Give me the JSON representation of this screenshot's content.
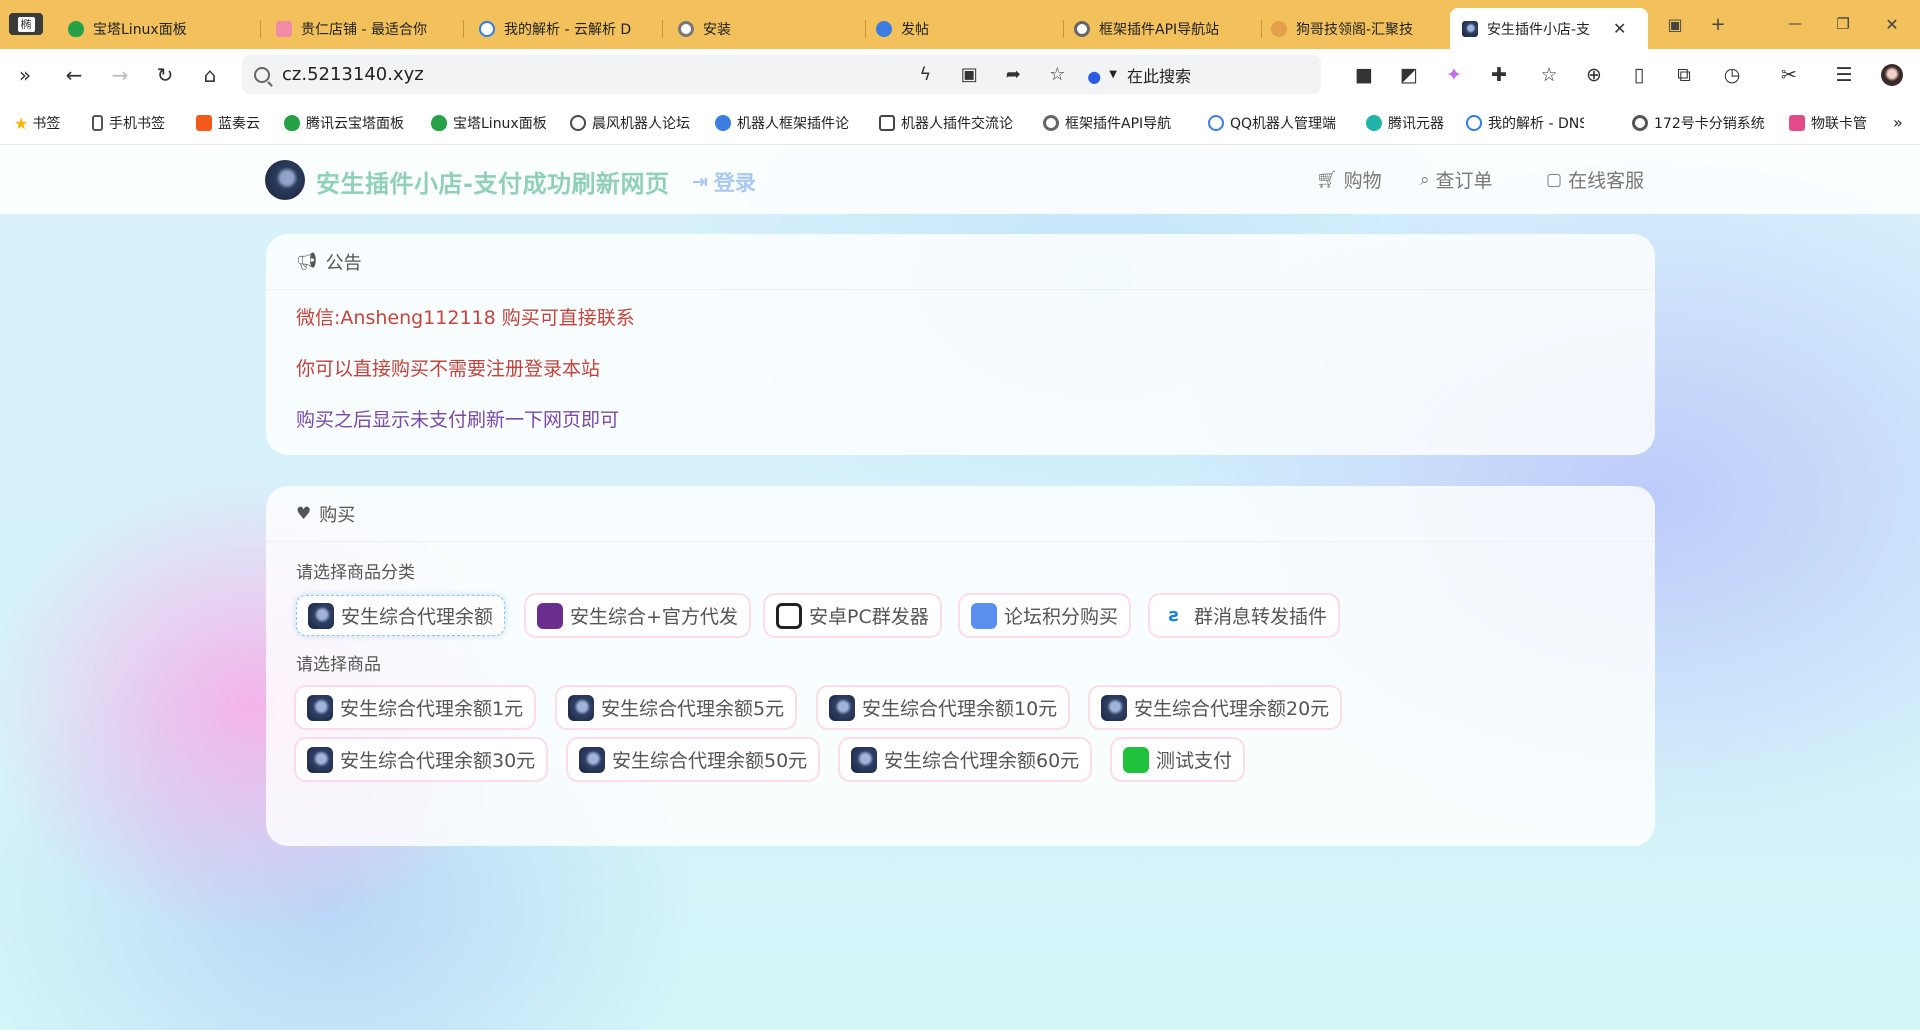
{
  "browser": {
    "tab_menu_label": "椭",
    "tabs": [
      {
        "label": "宝塔Linux面板",
        "color": "#26a148"
      },
      {
        "label": "贵仁店铺 - 最适合你",
        "color": "#f08aa5"
      },
      {
        "label": "我的解析 - 云解析 D",
        "color": "#2b7de9"
      },
      {
        "label": "安装",
        "color": "#777777"
      },
      {
        "label": "发帖",
        "color": "#3b7de0"
      },
      {
        "label": "框架插件API导航站",
        "color": "#666666"
      },
      {
        "label": "狗哥技领阁-汇聚技",
        "color": "#e3a04a"
      },
      {
        "label": "安生插件小店-支",
        "color": "#2c3c5d",
        "active": true
      }
    ],
    "active_tab_close": "✕",
    "new_tab": "+",
    "window_controls": {
      "minimize": "—",
      "restore": "❐",
      "close": "✕"
    },
    "url": "cz.5213140.xyz",
    "search_engine_label": "在此搜索",
    "bookmarks": [
      {
        "label": "书签",
        "color": "#f5b400"
      },
      {
        "label": "手机书签",
        "color": "#555555"
      },
      {
        "label": "蓝奏云",
        "color": "#f25a1a"
      },
      {
        "label": "腾讯云宝塔面板",
        "color": "#26a148"
      },
      {
        "label": "宝塔Linux面板",
        "color": "#26a148"
      },
      {
        "label": "晨风机器人论坛",
        "color": "#4a4a4a"
      },
      {
        "label": "机器人框架插件论",
        "color": "#3b7de0"
      },
      {
        "label": "机器人插件交流论",
        "color": "#444444"
      },
      {
        "label": "框架插件API导航",
        "color": "#666666"
      },
      {
        "label": "QQ机器人管理端",
        "color": "#3b7de0"
      },
      {
        "label": "腾讯元器",
        "color": "#22b4a8"
      },
      {
        "label": "我的解析 - DNS",
        "color": "#2b7de9"
      },
      {
        "label": "172号卡分销系统",
        "color": "#555555"
      },
      {
        "label": "物联卡管",
        "color": "#e24b8a"
      }
    ],
    "bookmarks_more": "»"
  },
  "site": {
    "title": "安生插件小店-支付成功刷新网页",
    "login_label": "登录",
    "nav": [
      {
        "label": "购物",
        "icon": "cart-icon"
      },
      {
        "label": "查订单",
        "icon": "search-icon"
      },
      {
        "label": "在线客服",
        "icon": "chat-icon"
      }
    ]
  },
  "notice": {
    "heading": "公告",
    "lines": [
      {
        "text": "微信:Ansheng112118 购买可直接联系",
        "color": "#c0453c"
      },
      {
        "text": "你可以直接购买不需要注册登录本站",
        "color": "#c0453c"
      },
      {
        "text": "购买之后显示未支付刷新一下网页即可",
        "color": "#7a4aa6"
      }
    ]
  },
  "shop": {
    "heading": "购买",
    "category_label": "请选择商品分类",
    "categories": [
      {
        "label": "安生综合代理余额",
        "selected": true
      },
      {
        "label": "安生综合+官方代发"
      },
      {
        "label": "安卓PC群发器"
      },
      {
        "label": "论坛积分购买"
      },
      {
        "label": "群消息转发插件"
      }
    ],
    "product_label": "请选择商品",
    "products": [
      {
        "label": "安生综合代理余额1元"
      },
      {
        "label": "安生综合代理余额5元"
      },
      {
        "label": "安生综合代理余额10元"
      },
      {
        "label": "安生综合代理余额20元"
      },
      {
        "label": "安生综合代理余额30元"
      },
      {
        "label": "安生综合代理余额50元"
      },
      {
        "label": "安生综合代理余额60元"
      },
      {
        "label": "测试支付"
      }
    ]
  }
}
